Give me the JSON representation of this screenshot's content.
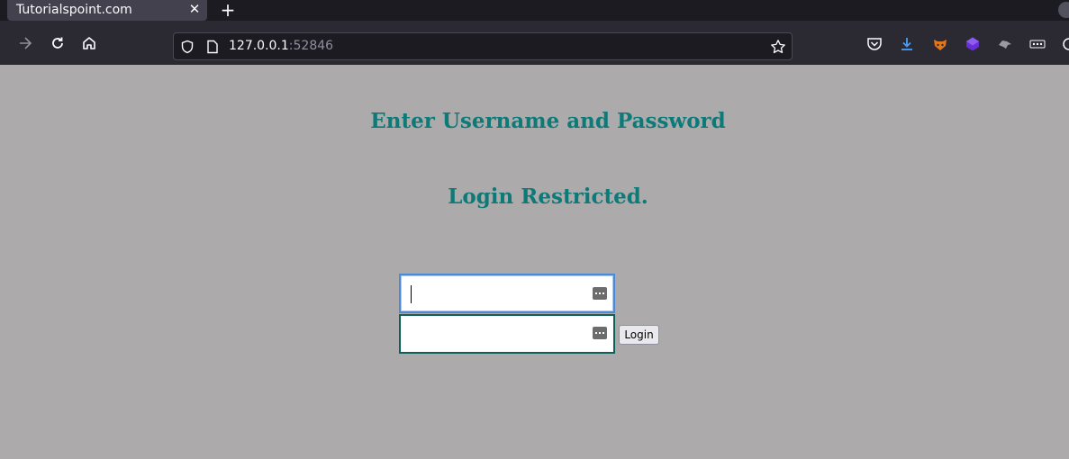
{
  "browser": {
    "tab": {
      "title": "Tutorialspoint.com",
      "close_glyph": "✕"
    },
    "new_tab_glyph": "+",
    "url": {
      "host": "127.0.0.1",
      "port": ":52846"
    },
    "nav_icons": [
      "back-icon",
      "reload-icon",
      "home-icon"
    ],
    "url_icons": [
      "shield-icon",
      "page-icon",
      "bookmark-star-icon"
    ],
    "toolbar_icons": [
      "pocket-icon",
      "downloads-icon",
      "extension-fox-icon",
      "extension-cube-icon",
      "extension-wolf-icon",
      "extension-dots-icon",
      "extension-bot-icon"
    ],
    "colors": {
      "tabbar": "#1c1b22",
      "navbar": "#2b2a33",
      "downloads": "#4b9bf5"
    }
  },
  "page": {
    "background": "#acaaab",
    "title": "Enter Username and Password",
    "message": "Login Restricted.",
    "heading_color": "#0d7a78",
    "form": {
      "username_value": "",
      "password_value": "",
      "login_label": "Login"
    }
  }
}
